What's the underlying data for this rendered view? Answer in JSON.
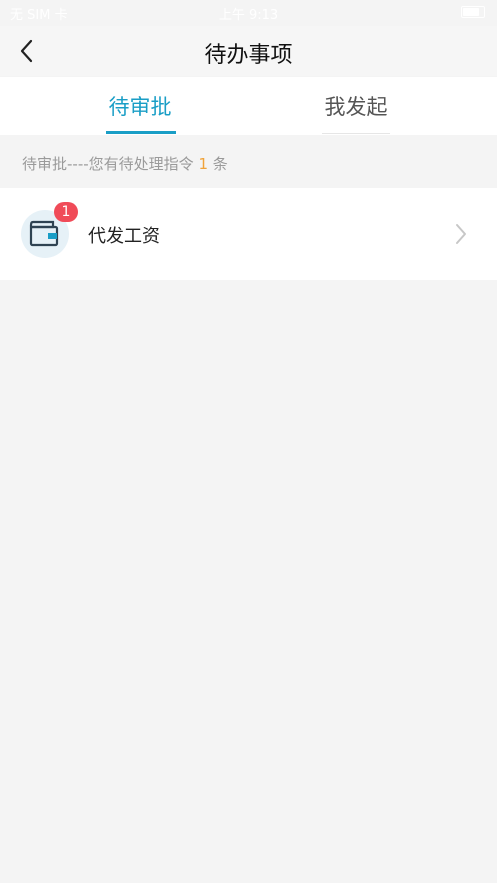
{
  "status_bar": {
    "carrier": "无 SIM 卡",
    "time": "上午 9:13"
  },
  "nav": {
    "title": "待办事项",
    "back_icon": "chevron-left-icon"
  },
  "tabs": [
    {
      "label": "待审批",
      "active": true
    },
    {
      "label": "我发起",
      "active": false
    }
  ],
  "notice": {
    "prefix": "待审批----您有待处理指令",
    "count": "1",
    "suffix": "条"
  },
  "items": [
    {
      "label": "代发工资",
      "badge": "1",
      "icon": "wallet-icon"
    }
  ],
  "colors": {
    "accent": "#1a9ec6",
    "badge": "#f04b58",
    "count": "#f0a33a",
    "background": "#f4f4f4"
  }
}
